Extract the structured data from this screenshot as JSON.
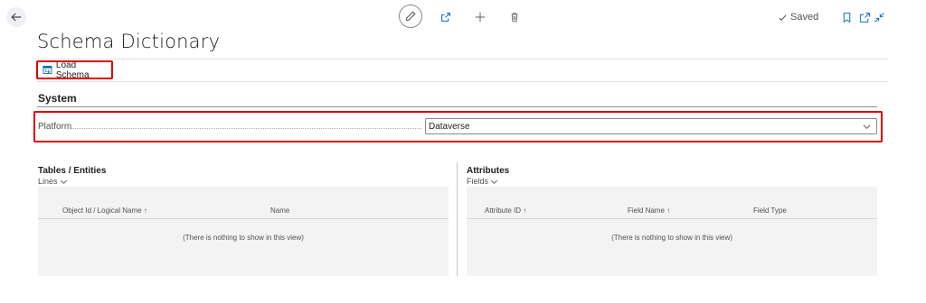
{
  "header": {
    "saved_label": "Saved",
    "title": "Schema Dictionary"
  },
  "actions": {
    "load_schema_label": "Load Schema"
  },
  "system": {
    "section_title": "System",
    "platform_label": "Platform",
    "platform_value": "Dataverse"
  },
  "tables_part": {
    "title": "Tables / Entities",
    "menu_label": "Lines",
    "columns": [
      "Object Id / Logical Name ↑",
      "Name"
    ],
    "empty_text": "(There is nothing to show in this view)"
  },
  "attributes_part": {
    "title": "Attributes",
    "menu_label": "Fields",
    "columns": [
      "Attribute ID ↑",
      "Field Name ↑",
      "Field Type"
    ],
    "empty_text": "(There is nothing to show in this view)"
  },
  "colors": {
    "highlight_red": "#e00000",
    "accent_blue": "#0f6cbd",
    "grid_bg": "#f3f3f3"
  },
  "icons": [
    "back-arrow-icon",
    "edit-pencil-icon",
    "share-icon",
    "plus-icon",
    "trash-icon",
    "checkmark-icon",
    "bookmark-icon",
    "open-new-window-icon",
    "collapse-icon",
    "load-schema-icon",
    "chevron-down-icon"
  ]
}
